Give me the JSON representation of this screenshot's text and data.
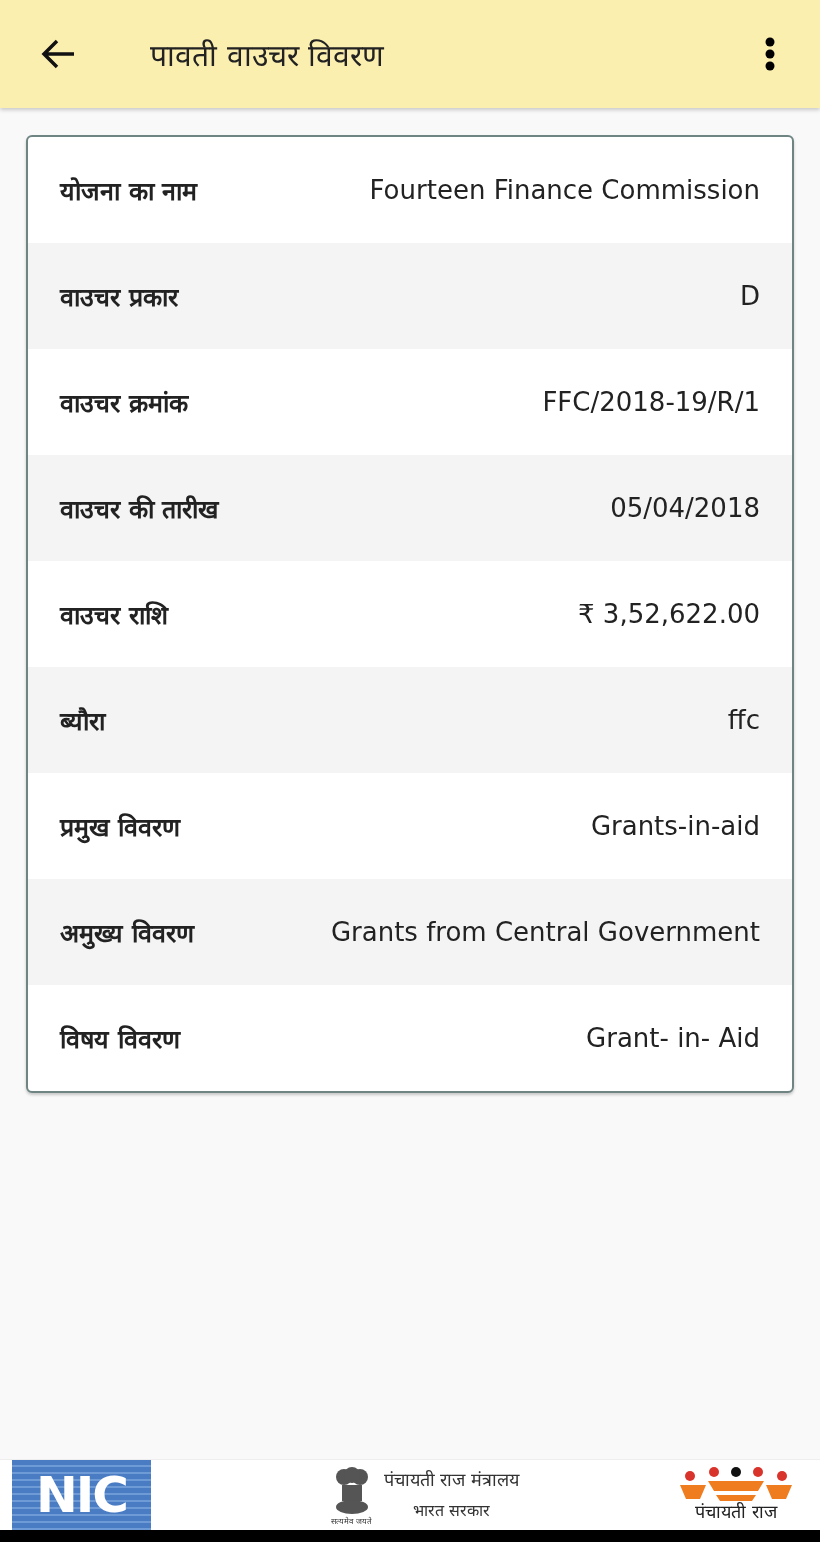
{
  "app_bar": {
    "title": "पावती वाउचर विवरण"
  },
  "details": [
    {
      "label": "योजना का नाम",
      "value": "Fourteen Finance Commission"
    },
    {
      "label": "वाउचर प्रकार",
      "value": "D"
    },
    {
      "label": "वाउचर क्रमांक",
      "value": "FFC/2018-19/R/1"
    },
    {
      "label": "वाउचर की तारीख",
      "value": "05/04/2018"
    },
    {
      "label": "वाउचर राशि",
      "value": "₹ 3,52,622.00"
    },
    {
      "label": "ब्यौरा",
      "value": "ffc"
    },
    {
      "label": "प्रमुख विवरण",
      "value": "Grants-in-aid"
    },
    {
      "label": "अमुख्य विवरण",
      "value": "Grants from Central Government"
    },
    {
      "label": "विषय विवरण",
      "value": "Grant- in- Aid"
    }
  ],
  "footer": {
    "nic_logo": "NIC",
    "ministry": "पंचायती राज मंत्रालय",
    "government": "भारत सरकार",
    "emblem_motto": "सत्यमेव जयते",
    "panchayati_logo": "पंचायती राज"
  }
}
